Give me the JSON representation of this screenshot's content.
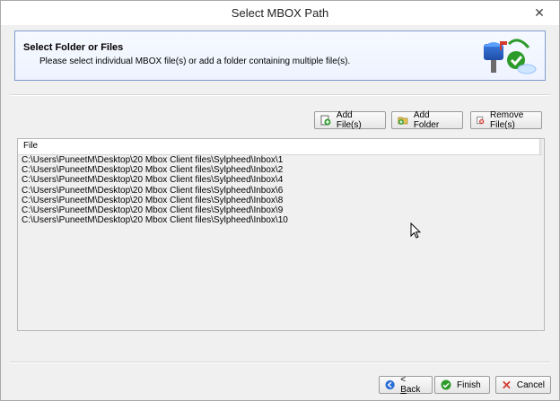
{
  "window": {
    "title": "Select MBOX Path"
  },
  "header": {
    "title": "Select Folder or Files",
    "subtitle": "Please select individual MBOX file(s) or add a folder containing multiple file(s)."
  },
  "actions": {
    "add_files": "Add File(s)",
    "add_folder": "Add Folder",
    "remove_files": "Remove File(s)"
  },
  "file_list": {
    "columns": [
      "File"
    ],
    "rows": [
      "C:\\Users\\PuneetM\\Desktop\\20 Mbox Client files\\Sylpheed\\Inbox\\1",
      "C:\\Users\\PuneetM\\Desktop\\20 Mbox Client files\\Sylpheed\\Inbox\\2",
      "C:\\Users\\PuneetM\\Desktop\\20 Mbox Client files\\Sylpheed\\Inbox\\4",
      "C:\\Users\\PuneetM\\Desktop\\20 Mbox Client files\\Sylpheed\\Inbox\\6",
      "C:\\Users\\PuneetM\\Desktop\\20 Mbox Client files\\Sylpheed\\Inbox\\8",
      "C:\\Users\\PuneetM\\Desktop\\20 Mbox Client files\\Sylpheed\\Inbox\\9",
      "C:\\Users\\PuneetM\\Desktop\\20 Mbox Client files\\Sylpheed\\Inbox\\10"
    ]
  },
  "footer": {
    "back_prefix": "< ",
    "back_accel": "B",
    "back_rest": "ack",
    "finish": "Finish",
    "cancel": "Cancel"
  },
  "icons": {
    "close": "close-icon",
    "mailbox": "mailbox-art-icon",
    "add_file": "add-file-icon",
    "add_folder": "add-folder-icon",
    "remove": "remove-icon",
    "back": "back-arrow-icon",
    "finish": "check-icon",
    "cancel": "cancel-x-icon"
  },
  "colors": {
    "header_border": "#7f9bd0",
    "add_green": "#2c9b2a",
    "remove_red": "#d23b2e",
    "back_blue": "#2b6fd6"
  }
}
